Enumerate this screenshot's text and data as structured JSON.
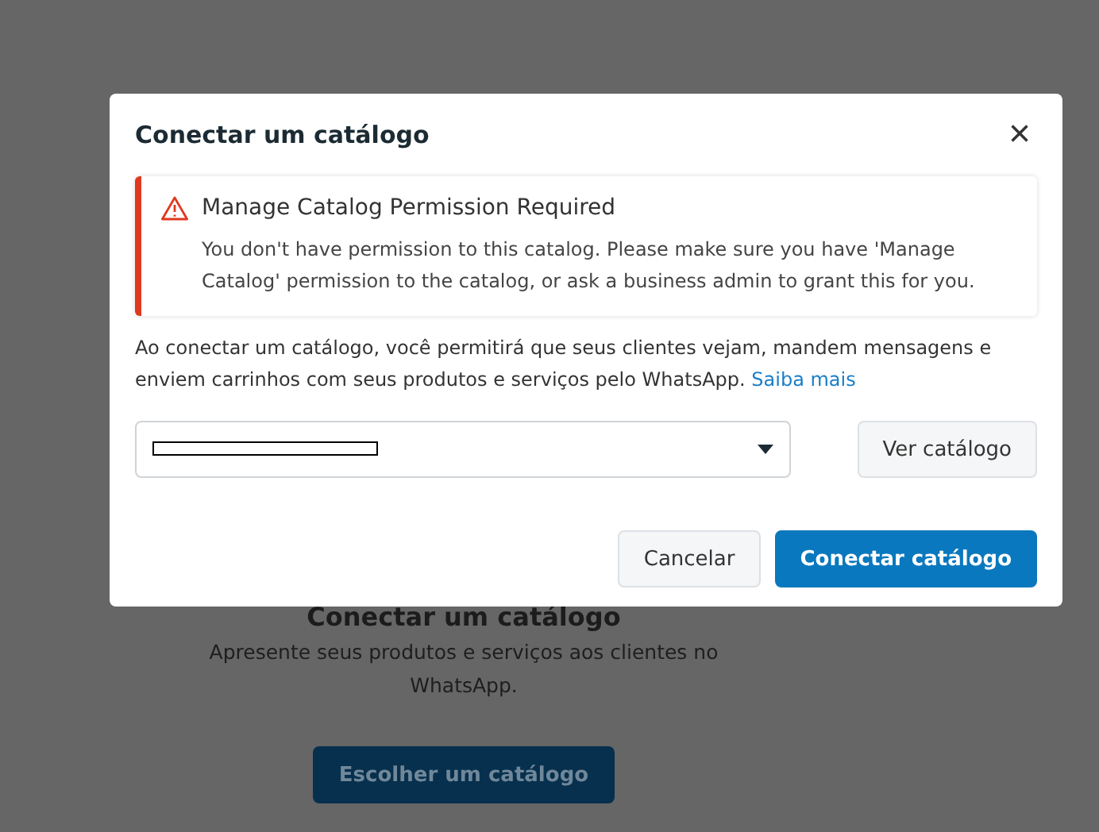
{
  "background": {
    "title": "Conectar um catálogo",
    "subtitle": "Apresente seus produtos e serviços aos clientes no WhatsApp.",
    "button": "Escolher um catálogo"
  },
  "dialog": {
    "title": "Conectar um catálogo",
    "close": "×",
    "alert": {
      "title": "Manage Catalog Permission Required",
      "message": "You don't have permission to this catalog. Please make sure you have 'Manage Catalog' permission to the catalog, or ask a business admin to grant this for you."
    },
    "description": "Ao conectar um catálogo, você permitirá que seus clientes vejam, mandem mensagens e enviem carrinhos com seus produtos e serviços pelo WhatsApp.",
    "link": "Saiba mais",
    "select": {
      "redacted": true
    },
    "view_button": "Ver catálogo",
    "buttons": [
      {
        "label": "Cancelar",
        "kind": "secondary"
      },
      {
        "label": "Conectar catálogo",
        "kind": "primary"
      }
    ]
  }
}
